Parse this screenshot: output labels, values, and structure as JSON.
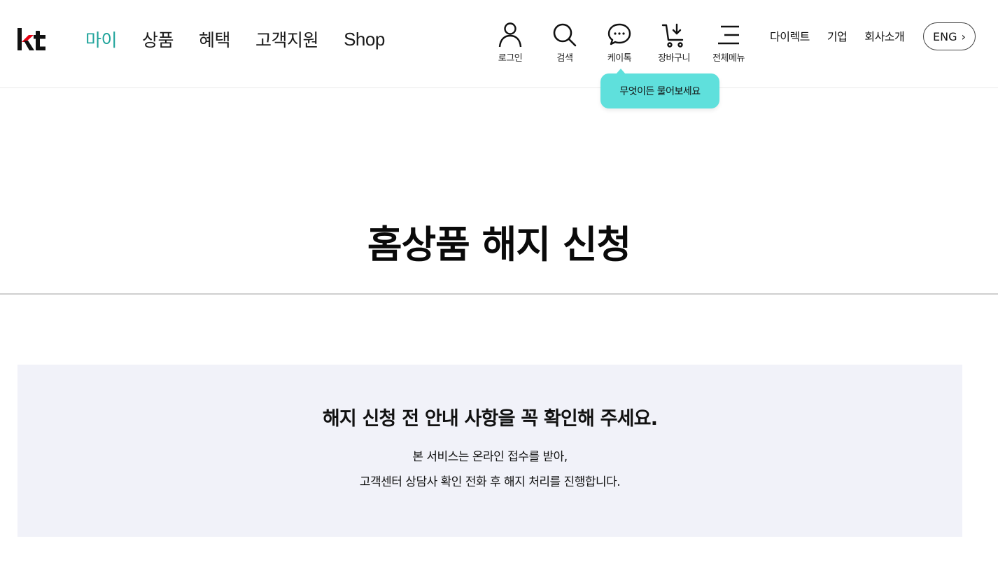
{
  "header": {
    "logo_text": "kt",
    "brand_colors": {
      "logo_black": "#111111",
      "logo_red": "#e60012",
      "accent": "#1ea39a"
    },
    "gnb": [
      {
        "label": "마이",
        "active": true
      },
      {
        "label": "상품",
        "active": false
      },
      {
        "label": "혜택",
        "active": false
      },
      {
        "label": "고객지원",
        "active": false
      },
      {
        "label": "Shop",
        "active": false
      }
    ],
    "utility": [
      {
        "icon": "user-icon",
        "label": "로그인"
      },
      {
        "icon": "search-icon",
        "label": "검색"
      },
      {
        "icon": "chat-icon",
        "label": "케이톡"
      },
      {
        "icon": "cart-icon",
        "label": "장바구니"
      },
      {
        "icon": "menu-icon",
        "label": "전체메뉴"
      }
    ],
    "tooltip": {
      "text": "무엇이든 물어보세요",
      "color": "#5fe0dc"
    },
    "sub_links": [
      "다이렉트",
      "기업",
      "회사소개"
    ],
    "lang_button": {
      "label": "ENG",
      "chevron": "›"
    }
  },
  "main": {
    "title": "홈상품 해지 신청",
    "notice": {
      "title": "해지 신청 전 안내 사항을 꼭 확인해 주세요.",
      "lines": [
        "본 서비스는 온라인 접수를 받아,",
        "고객센터 상담사 확인 전화 후 해지 처리를 진행합니다."
      ],
      "background": "#f1f2f9"
    }
  }
}
